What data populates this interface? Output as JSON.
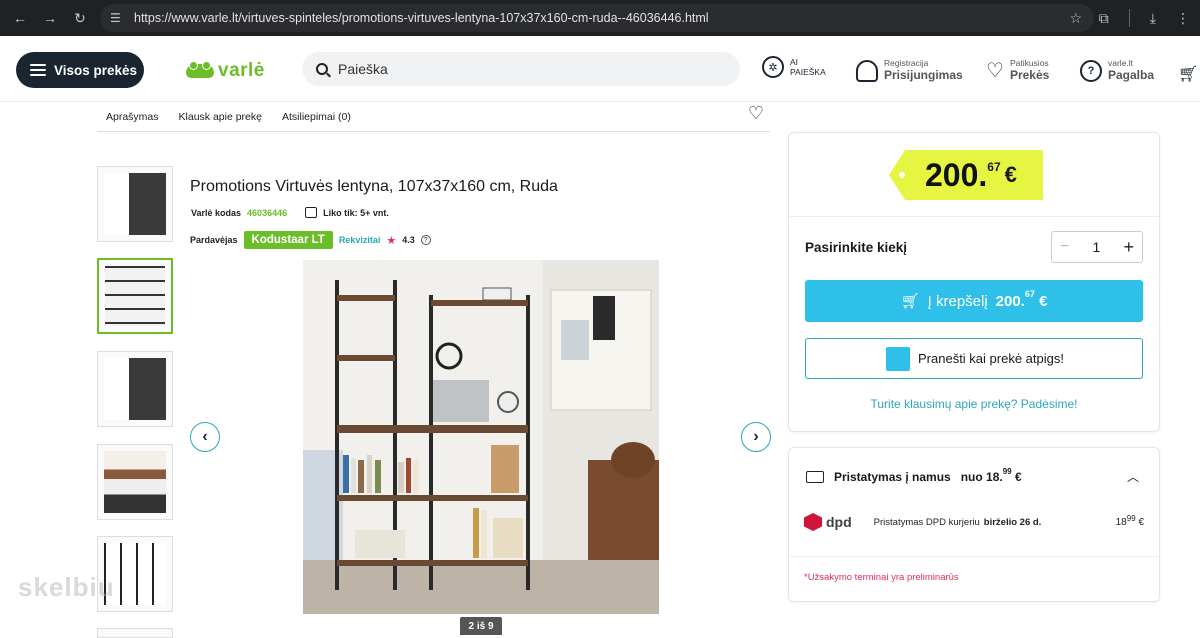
{
  "browser": {
    "url": "https://www.varle.lt/virtuves-spinteles/promotions-virtuves-lentyna-107x37x160-cm-ruda--46036446.html"
  },
  "header": {
    "all_products": "Visos prekės",
    "logo_text": "varlė",
    "search_placeholder": "Paieška",
    "ai_search_top": "AI",
    "ai_search_bottom": "PAIEŠKA",
    "account_small": "Registracija",
    "account_big": "Prisijungimas",
    "favorites_small": "Patikusios",
    "favorites_big": "Prekės",
    "help_small": "varle.lt",
    "help_big": "Pagalba"
  },
  "tabs": [
    "Aprašymas",
    "Klausk apie prekę",
    "Atsiliepimai (0)"
  ],
  "product": {
    "title": "Promotions Virtuvės lentyna, 107x37x160 cm, Ruda",
    "code_label": "Varlė kodas",
    "code": "46036446",
    "stock": "Liko tik: 5+ vnt.",
    "seller_label": "Pardavėjas",
    "seller": "Kodustaar LT",
    "requisites": "Rekvizitai",
    "rating": "4.3",
    "image_counter": "2 iš 9"
  },
  "watermark": "skelbiu",
  "buy": {
    "price_int": "200.",
    "price_cents": "67",
    "currency": "€",
    "qty_label": "Pasirinkite kiekį",
    "qty_value": "1",
    "cart_label": "Į krepšelį",
    "cart_price_int": "200.",
    "cart_price_cents": "67",
    "notify_label": "Pranešti kai prekė atpigs!",
    "help_link": "Turite klausimų apie prekę? Padėsime!"
  },
  "delivery": {
    "title": "Pristatymas į namus",
    "from": "nuo 18.",
    "from_cents": "99",
    "from_cur": "€",
    "dpd_logo": "dpd",
    "dpd_text": "Pristatymas DPD kurjeriu",
    "dpd_date": "birželio 26 d.",
    "dpd_fee_int": "18",
    "dpd_fee_cents": "99",
    "dpd_fee_cur": "€",
    "note": "*Užsakymo terminai yra preliminarūs"
  }
}
